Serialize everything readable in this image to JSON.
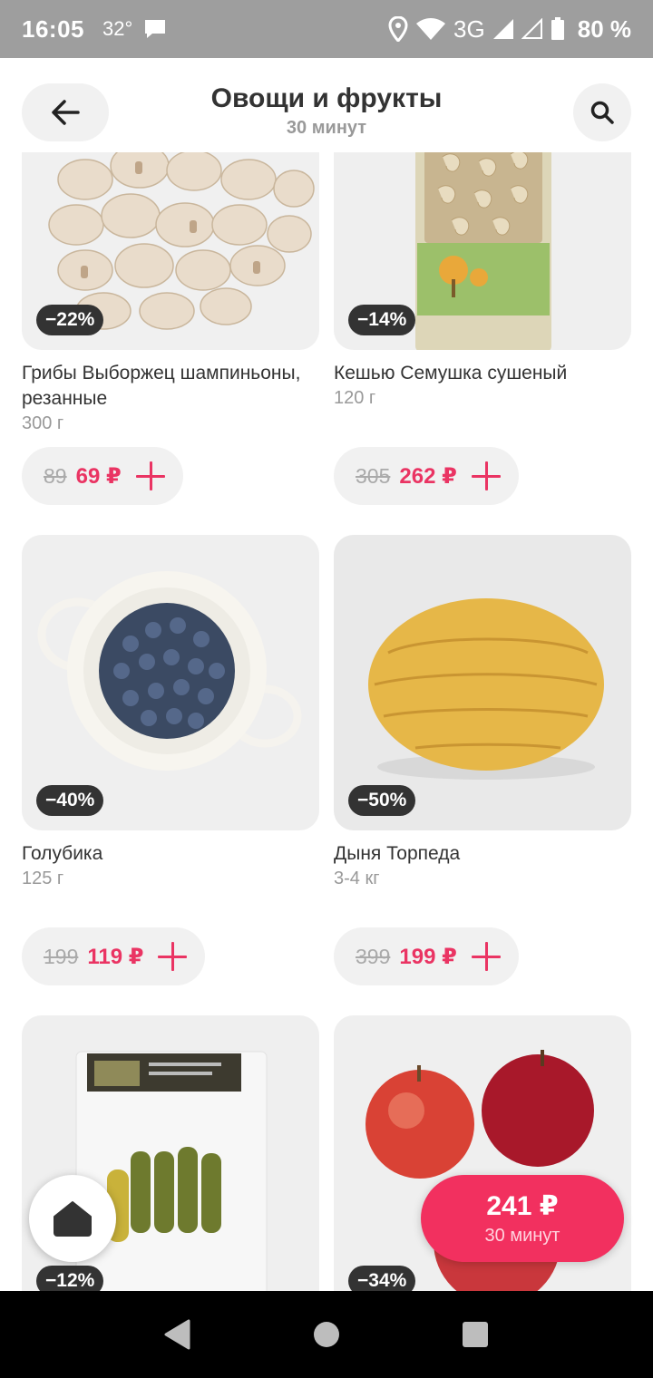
{
  "status_bar": {
    "time": "16:05",
    "temperature": "32°",
    "network": "3G",
    "battery": "80 %"
  },
  "header": {
    "title": "Овощи и фрукты",
    "subtitle": "30 минут",
    "back_icon": "arrow-left-icon",
    "search_icon": "search-icon"
  },
  "products": [
    {
      "name": "Грибы Выборжец шампиньоны, резанные",
      "weight": "300 г",
      "discount": "−22%",
      "old_price": "89",
      "new_price": "69 ₽"
    },
    {
      "name": "Кешью Семушка сушеный",
      "weight": "120 г",
      "discount": "−14%",
      "old_price": "305",
      "new_price": "262 ₽"
    },
    {
      "name": "Голубика",
      "weight": "125 г",
      "discount": "−40%",
      "old_price": "199",
      "new_price": "119 ₽"
    },
    {
      "name": "Дыня Торпеда",
      "weight": "3-4 кг",
      "discount": "−50%",
      "old_price": "399",
      "new_price": "199 ₽"
    },
    {
      "discount": "−12%"
    },
    {
      "discount": "−34%"
    }
  ],
  "cart": {
    "total": "241 ₽",
    "eta": "30 минут"
  },
  "colors": {
    "accent": "#ea3463",
    "cart_button": "#f2305f",
    "status_bar": "#9e9e9e"
  }
}
